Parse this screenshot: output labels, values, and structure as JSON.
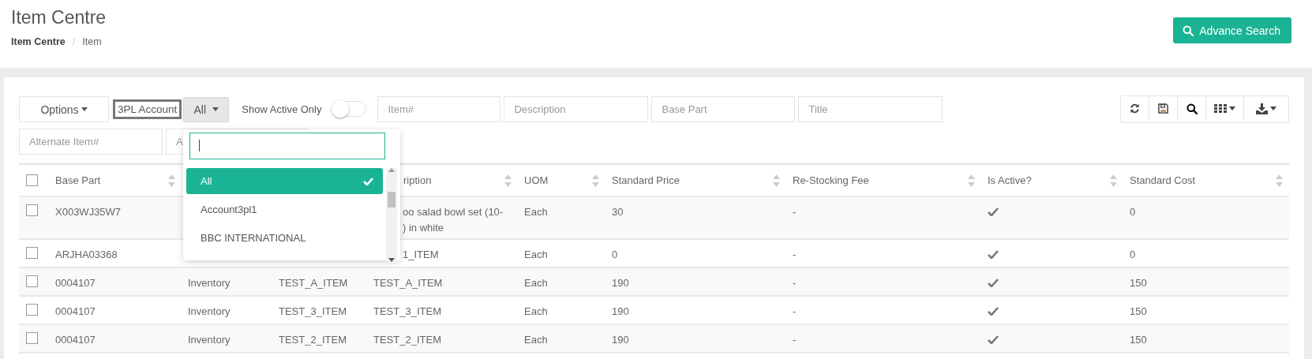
{
  "page": {
    "title": "Item Centre",
    "breadcrumb": [
      "Item Centre",
      "Item"
    ],
    "breadcrumb_separator": "/",
    "advance_search_button": "Advance Search"
  },
  "toolbar": {
    "options_button": "Options",
    "account_label": "3PL Account",
    "account_select": "All",
    "show_active_only": {
      "label": "Show Active Only",
      "on": false
    },
    "filters": [
      {
        "placeholder": "Item#"
      },
      {
        "placeholder": "Description"
      },
      {
        "placeholder": "Base Part"
      },
      {
        "placeholder": "Title"
      },
      {
        "placeholder": "Alternate Item#"
      },
      {
        "placeholder": "A"
      }
    ],
    "icon_buttons": [
      {
        "kind": "refresh"
      },
      {
        "kind": "save"
      },
      {
        "kind": "search"
      },
      {
        "kind": "columns"
      },
      {
        "kind": "export"
      }
    ]
  },
  "account_dropdown": {
    "open": true,
    "options": [
      {
        "label": "All",
        "selected": true
      },
      {
        "label": "Account3pl1",
        "selected": false
      },
      {
        "label": "BBC INTERNATIONAL",
        "selected": false
      }
    ]
  },
  "table": {
    "select_all_checked": false,
    "columns": [
      {
        "label": "Base Part",
        "sortable": true
      },
      {},
      {},
      {
        "label": "ription",
        "sortable": true
      },
      {
        "label": "UOM",
        "sortable": true
      },
      {
        "label": "Standard Price",
        "sortable": true
      },
      {
        "label": "Re-Stocking Fee",
        "sortable": true
      },
      {
        "label": "Is Active?",
        "sortable": true
      },
      {
        "label": "Standard Cost",
        "sortable": true
      }
    ],
    "rows": [
      {
        "checked": false,
        "base_part": "X003WJ35W7",
        "description": "oo salad bowl set (10-\n) in white",
        "uom": "Each",
        "standard_price": "30",
        "re_stocking_fee": "-",
        "is_active": true,
        "standard_cost": "0"
      },
      {
        "checked": false,
        "base_part": "ARJHA03368",
        "description": "1_ITEM",
        "uom": "Each",
        "standard_price": "0",
        "re_stocking_fee": "-",
        "is_active": true,
        "standard_cost": "0"
      },
      {
        "checked": false,
        "base_part": "0004107",
        "column_2": "Inventory",
        "column_3": "TEST_A_ITEM",
        "description": "TEST_A_ITEM",
        "uom": "Each",
        "standard_price": "190",
        "re_stocking_fee": "-",
        "is_active": true,
        "standard_cost": "150"
      },
      {
        "checked": false,
        "base_part": "0004107",
        "column_2": "Inventory",
        "column_3": "TEST_3_ITEM",
        "description": "TEST_3_ITEM",
        "uom": "Each",
        "standard_price": "190",
        "re_stocking_fee": "-",
        "is_active": true,
        "standard_cost": "150"
      },
      {
        "checked": false,
        "base_part": "0004107",
        "column_2": "Inventory",
        "column_3": "TEST_2_ITEM",
        "description": "TEST_2_ITEM",
        "uom": "Each",
        "standard_price": "190",
        "re_stocking_fee": "-",
        "is_active": true,
        "standard_cost": "150"
      }
    ]
  }
}
